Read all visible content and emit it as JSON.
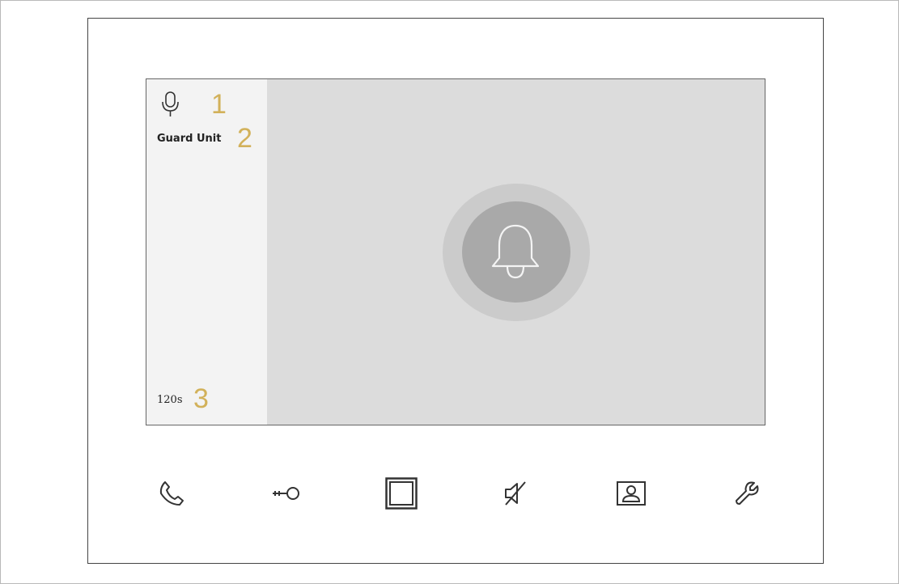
{
  "screen": {
    "unit_name": "Guard Unit",
    "timer": "120s",
    "callouts": [
      "1",
      "2",
      "3"
    ]
  },
  "icons": {
    "microphone": "microphone-icon",
    "bell": "bell-icon"
  },
  "toolbar": {
    "buttons": [
      {
        "name": "call",
        "icon": "phone-icon"
      },
      {
        "name": "unlock",
        "icon": "key-icon"
      },
      {
        "name": "screen",
        "icon": "square-frame-icon"
      },
      {
        "name": "mute",
        "icon": "speaker-muted-icon"
      },
      {
        "name": "photo",
        "icon": "portrait-icon"
      },
      {
        "name": "settings",
        "icon": "wrench-icon"
      }
    ]
  },
  "colors": {
    "callout": "#d2b15a",
    "screen_bg": "#dcdcdc",
    "panel_bg": "#f3f3f3",
    "bell_ring_outer": "#cbcbcb",
    "bell_ring_inner": "#a9a9a9"
  }
}
